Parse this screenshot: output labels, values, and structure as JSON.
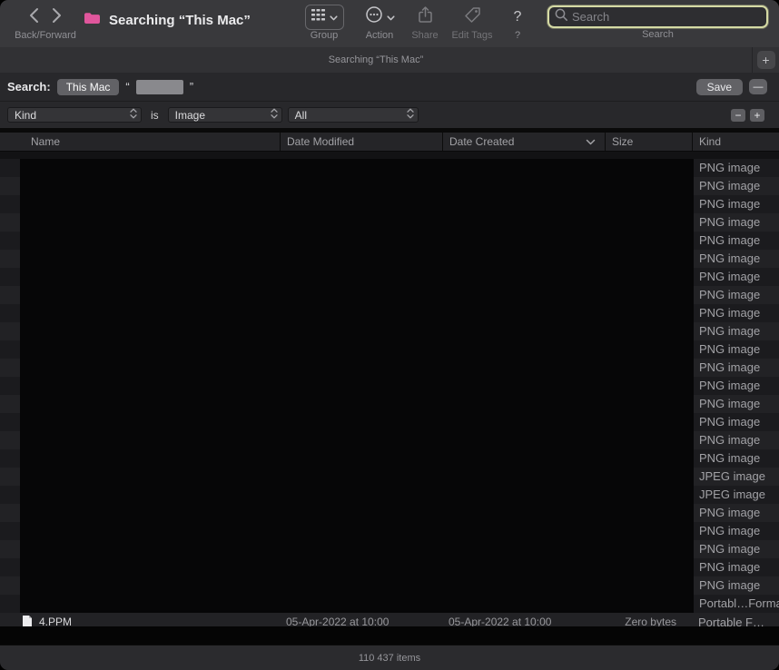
{
  "window": {
    "title": "Searching “This Mac”"
  },
  "toolbar": {
    "back_forward_label": "Back/Forward",
    "group_label": "Group",
    "action_label": "Action",
    "share_label": "Share",
    "edit_tags_label": "Edit Tags",
    "help_icon": "?",
    "help_label": "?",
    "search_placeholder": "Search",
    "search_label": "Search"
  },
  "tab_bar": {
    "active_tab_title": "Searching “This Mac”",
    "new_tab_button": "+"
  },
  "saved_search_bar": {
    "label": "Search:",
    "scope_button": "This Mac",
    "open_quote": "“",
    "close_quote": "”",
    "save_button": "Save",
    "collapse_button": "—"
  },
  "criteria_row": {
    "attribute_popup": "Kind",
    "operator": "is",
    "value_popup": "Image",
    "scope_popup": "All",
    "remove_button": "−",
    "add_button": "+"
  },
  "results": {
    "columns": {
      "name": "Name",
      "date_modified": "Date Modified",
      "date_created": "Date Created",
      "size": "Size",
      "kind": "Kind"
    },
    "sort_column": "Date Created",
    "kinds": [
      "PNG image",
      "PNG image",
      "PNG image",
      "PNG image",
      "PNG image",
      "PNG image",
      "PNG image",
      "PNG image",
      "PNG image",
      "PNG image",
      "PNG image",
      "PNG image",
      "PNG image",
      "PNG image",
      "PNG image",
      "PNG image",
      "PNG image",
      "JPEG image",
      "JPEG image",
      "PNG image",
      "PNG image",
      "PNG image",
      "PNG image",
      "PNG image",
      "Portabl…Format"
    ],
    "partial_row": {
      "name": "4.PPM",
      "date_modified": "05-Apr-2022 at 10:00",
      "date_created": "05-Apr-2022 at 10:00",
      "size": "Zero bytes",
      "kind": "Portable F…"
    }
  },
  "status_bar": {
    "items_text": "110 437 items"
  },
  "colors": {
    "focus_ring": "#d5daa4",
    "folder_icon": "#e0569c",
    "redaction": "#060607"
  }
}
